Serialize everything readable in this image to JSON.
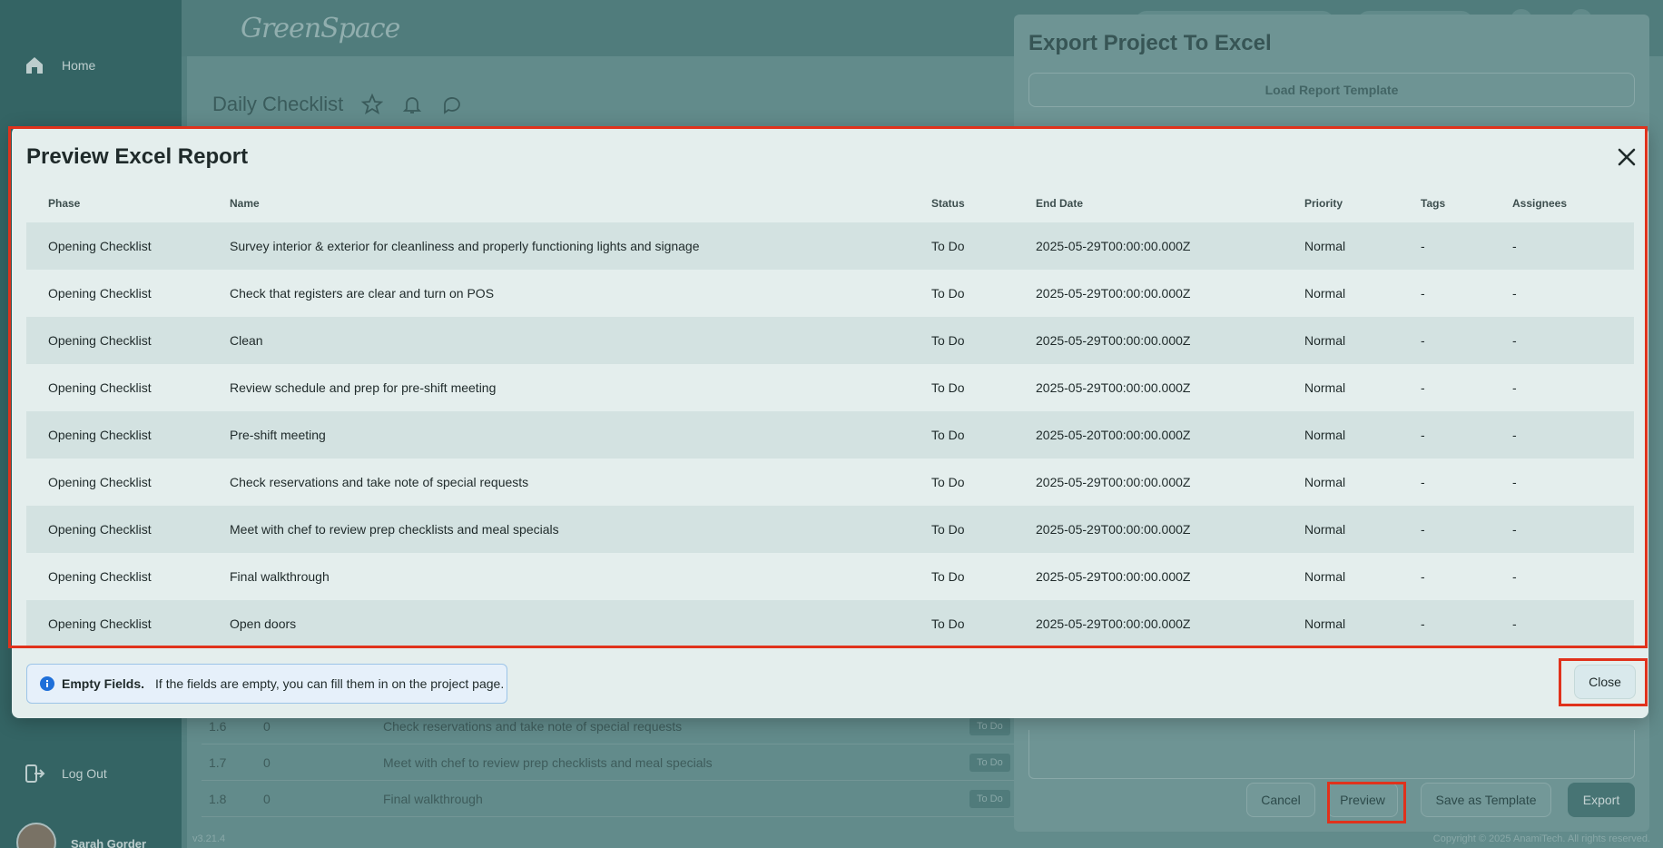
{
  "sidebar": {
    "home_label": "Home",
    "logout_label": "Log Out",
    "user_name": "Sarah Gorder",
    "version": "v3.21.4"
  },
  "topbar": {
    "logo_text": "GreenSpace"
  },
  "page": {
    "title": "Daily Checklist"
  },
  "background_rows": [
    {
      "num": "1.6",
      "val": "0",
      "name": "Check reservations and take note of special requests",
      "status": "To Do"
    },
    {
      "num": "1.7",
      "val": "0",
      "name": "Meet with chef to review prep checklists and meal specials",
      "status": "To Do"
    },
    {
      "num": "1.8",
      "val": "0",
      "name": "Final walkthrough",
      "status": "To Do"
    }
  ],
  "export_panel": {
    "title": "Export Project To Excel",
    "load_template_label": "Load Report Template",
    "cancel_label": "Cancel",
    "preview_label": "Preview",
    "save_template_label": "Save as Template",
    "export_label": "Export",
    "copyright": "Copyright © 2025 AnamiTech. All rights reserved."
  },
  "modal": {
    "title": "Preview Excel Report",
    "columns": [
      "Phase",
      "Name",
      "Status",
      "End Date",
      "Priority",
      "Tags",
      "Assignees"
    ],
    "rows": [
      [
        "Opening Checklist",
        "Survey interior & exterior for cleanliness and properly functioning lights and signage",
        "To Do",
        "2025-05-29T00:00:00.000Z",
        "Normal",
        "-",
        "-"
      ],
      [
        "Opening Checklist",
        "Check that registers are clear and turn on POS",
        "To Do",
        "2025-05-29T00:00:00.000Z",
        "Normal",
        "-",
        "-"
      ],
      [
        "Opening Checklist",
        "Clean",
        "To Do",
        "2025-05-29T00:00:00.000Z",
        "Normal",
        "-",
        "-"
      ],
      [
        "Opening Checklist",
        "Review schedule and prep for pre-shift meeting",
        "To Do",
        "2025-05-29T00:00:00.000Z",
        "Normal",
        "-",
        "-"
      ],
      [
        "Opening Checklist",
        "Pre-shift meeting",
        "To Do",
        "2025-05-20T00:00:00.000Z",
        "Normal",
        "-",
        "-"
      ],
      [
        "Opening Checklist",
        "Check reservations and take note of special requests",
        "To Do",
        "2025-05-29T00:00:00.000Z",
        "Normal",
        "-",
        "-"
      ],
      [
        "Opening Checklist",
        "Meet with chef to review prep checklists and meal specials",
        "To Do",
        "2025-05-29T00:00:00.000Z",
        "Normal",
        "-",
        "-"
      ],
      [
        "Opening Checklist",
        "Final walkthrough",
        "To Do",
        "2025-05-29T00:00:00.000Z",
        "Normal",
        "-",
        "-"
      ],
      [
        "Opening Checklist",
        "Open doors",
        "To Do",
        "2025-05-29T00:00:00.000Z",
        "Normal",
        "-",
        "-"
      ]
    ],
    "info_title": "Empty Fields.",
    "info_text": "If the fields are empty, you can fill them in on the project page.",
    "close_label": "Close"
  },
  "colors": {
    "highlight": "#e0321c",
    "info_icon": "#1e6fd9"
  }
}
